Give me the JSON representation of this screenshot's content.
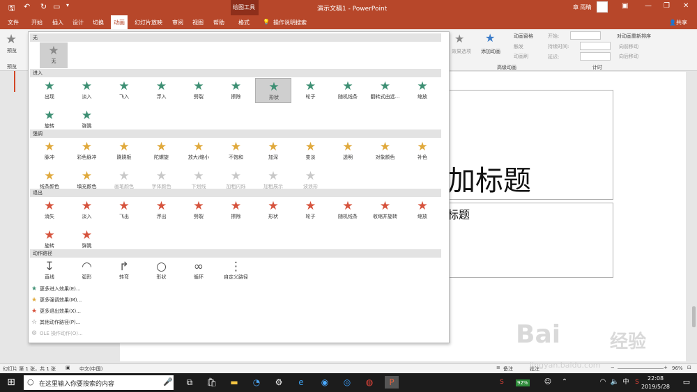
{
  "titlebar": {
    "title": "演示文稿1  -  PowerPoint",
    "context_group": "绘图工具",
    "user": "章 雨晴"
  },
  "tabs": [
    "文件",
    "开始",
    "插入",
    "设计",
    "切换",
    "动画",
    "幻灯片放映",
    "审阅",
    "视图",
    "帮助",
    "格式"
  ],
  "active_tab": "动画",
  "tellme": "操作说明搜索",
  "share": "共享",
  "ribbon": {
    "preview_label": "预览",
    "preview_group": "预览",
    "effect_options": "效果选项",
    "add_animation": "添加动画",
    "animation_pane": "动画窗格",
    "trigger": "触发",
    "animation_painter": "动画刷",
    "advanced_group": "高级动画",
    "start_label": "开始:",
    "duration_label": "持续时间:",
    "delay_label": "延迟:",
    "reorder_label": "对动画重新排序",
    "move_earlier": "向前移动",
    "move_later": "向后移动",
    "timing_group": "计时"
  },
  "gallery": {
    "none_header": "无",
    "none_item": "无",
    "entrance_header": "进入",
    "entrance": [
      "出现",
      "淡入",
      "飞入",
      "浮入",
      "劈裂",
      "擦除",
      "形状",
      "轮子",
      "随机线条",
      "翻转式由远...",
      "缩放",
      "旋转",
      "弹跳"
    ],
    "emphasis_header": "强调",
    "emphasis": [
      "脉冲",
      "彩色脉冲",
      "跷跷板",
      "陀螺旋",
      "放大/缩小",
      "不饱和",
      "加深",
      "变淡",
      "透明",
      "对象颜色",
      "补色",
      "线条颜色",
      "填充颜色",
      "画笔颜色",
      "字体颜色",
      "下划线",
      "加粗闪烁",
      "加粗展示",
      "波浪形"
    ],
    "emphasis_disabled": [
      "画笔颜色",
      "字体颜色",
      "下划线",
      "加粗闪烁",
      "加粗展示",
      "波浪形"
    ],
    "exit_header": "退出",
    "exit": [
      "消失",
      "淡入",
      "飞出",
      "浮出",
      "劈裂",
      "擦除",
      "形状",
      "轮子",
      "随机线条",
      "收缩并旋转",
      "缩放",
      "旋转",
      "弹跳"
    ],
    "path_header": "动作路径",
    "paths": [
      "直线",
      "弧形",
      "转弯",
      "形状",
      "循环",
      "自定义路径"
    ],
    "more": [
      "更多进入效果(E)...",
      "更多强调效果(M)...",
      "更多退出效果(X)...",
      "其他动作路径(P)...",
      "OLE 操作动作(O)..."
    ],
    "selected": "形状"
  },
  "slide": {
    "title_fragment": "加标题",
    "subtitle_fragment": "标题"
  },
  "status": {
    "slide_info": "幻灯片 第 1 张，共 1 张",
    "language": "中文(中国)",
    "notes": "备注",
    "comments": "批注",
    "zoom": "96%"
  },
  "taskbar": {
    "search_placeholder": "在这里输入你要搜索的内容",
    "time": "22:08",
    "date": "2019/5/28",
    "battery": "92%"
  },
  "watermark": {
    "brand": "Bai",
    "brand2": "经验",
    "url": "jingyan.baidu.com"
  },
  "colors": {
    "brand": "#b7472a",
    "entrance": "#3d8f73",
    "emphasis": "#e0a93c",
    "exit": "#d6533d"
  }
}
